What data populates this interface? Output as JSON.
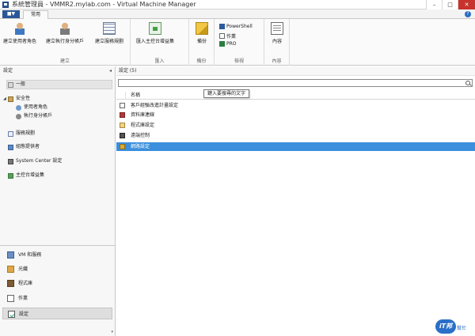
{
  "window": {
    "title": "系統管理員 - VMMR2.mylab.com - Virtual Machine Manager",
    "controls": {
      "minimize": "–",
      "maximize": "□",
      "close": "✕"
    }
  },
  "ribbon": {
    "file_tab": "■▼",
    "tabs": [
      "常用"
    ],
    "groups": [
      {
        "label": "建立",
        "buttons": [
          "建立使用者角色",
          "建立執行身分帳戶",
          "建立服務規劃"
        ]
      },
      {
        "label": "匯入",
        "buttons": [
          "匯入主控台增益集"
        ]
      },
      {
        "label": "備份",
        "buttons": [
          "備份"
        ]
      },
      {
        "label": "檢視",
        "small_buttons": [
          "PowerShell",
          "作業",
          "PRO"
        ]
      },
      {
        "label": "內容",
        "buttons": [
          "內容"
        ]
      }
    ],
    "help": "?"
  },
  "left_pane": {
    "header": "設定",
    "collapse": "◂",
    "items": [
      {
        "label": "一般",
        "icon": "general-icon",
        "selected": true
      },
      {
        "label": "安全性",
        "icon": "security-icon",
        "expanded": true
      },
      {
        "label": "使用者角色",
        "icon": "user-role-icon"
      },
      {
        "label": "執行身分帳戶",
        "icon": "run-as-icon"
      },
      {
        "label": "服務規劃",
        "icon": "service-template-icon"
      },
      {
        "label": "組態提供者",
        "icon": "config-provider-icon"
      },
      {
        "label": "System Center 設定",
        "icon": "system-center-icon"
      },
      {
        "label": "主控台增益集",
        "icon": "console-addin-icon"
      }
    ]
  },
  "wunderbar": {
    "items": [
      {
        "label": "VM 和服務",
        "icon": "vm-services-icon"
      },
      {
        "label": "光纖",
        "icon": "fabric-icon"
      },
      {
        "label": "程式庫",
        "icon": "library-icon"
      },
      {
        "label": "作業",
        "icon": "jobs-icon"
      },
      {
        "label": "設定",
        "icon": "settings-icon",
        "active": true
      }
    ]
  },
  "right_pane": {
    "header": "設定 (5)",
    "search": {
      "value": "",
      "placeholder": ""
    },
    "tooltip": "鍵入要搜尋的文字",
    "columns": {
      "name": "名稱"
    },
    "rows": [
      {
        "name": "客戶經驗改進計畫設定",
        "icon": "ceip-icon"
      },
      {
        "name": "資料庫連線",
        "icon": "database-icon"
      },
      {
        "name": "程式庫設定",
        "icon": "library-settings-icon"
      },
      {
        "name": "遠端控制",
        "icon": "remote-control-icon"
      },
      {
        "name": "網路設定",
        "icon": "network-settings-icon",
        "selected": true
      }
    ]
  },
  "watermark": {
    "badge": "iT邦",
    "text": "幫忙"
  },
  "colors": {
    "accent": "#2b5797",
    "selection": "#3b8fdd",
    "close": "#c7322c"
  }
}
